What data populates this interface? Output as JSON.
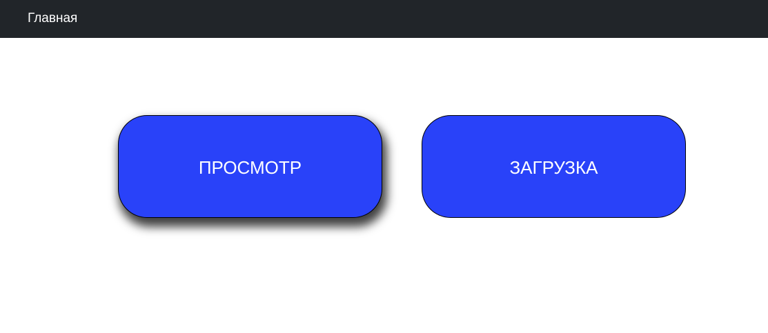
{
  "navbar": {
    "home_label": "Главная",
    "background": "#212529"
  },
  "actions": {
    "view_label": "ПРОСМОТР",
    "upload_label": "ЗАГРУЗКА",
    "button_color": "#2942f9"
  }
}
